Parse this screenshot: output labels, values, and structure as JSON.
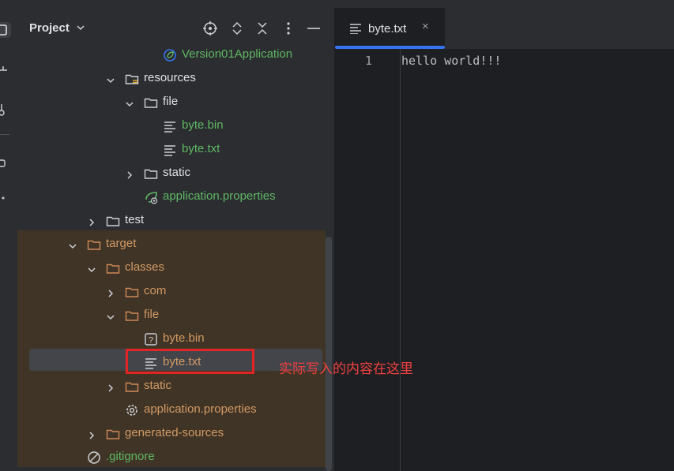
{
  "colors": {
    "normal_text": "#dfe1e5",
    "green_text": "#5fb865",
    "orange_text": "#d39a64",
    "excluded_bg": "#3f3426",
    "accent": "#3574f0",
    "annotation": "#e32424"
  },
  "project_panel": {
    "title": "Project",
    "header_icons": [
      "locate-icon",
      "expand-all-icon",
      "collapse-all-icon",
      "options-icon",
      "hide-icon"
    ]
  },
  "tree": [
    {
      "label": "Version01Application",
      "icon": "spring-boot-app-icon",
      "expanded": null,
      "color": "green"
    },
    {
      "label": "resources",
      "icon": "resources-folder-icon",
      "expanded": true,
      "color": "normal"
    },
    {
      "label": "file",
      "icon": "folder-icon",
      "expanded": true,
      "color": "normal"
    },
    {
      "label": "byte.bin",
      "icon": "text-file-icon",
      "expanded": null,
      "color": "green"
    },
    {
      "label": "byte.txt",
      "icon": "text-file-icon",
      "expanded": null,
      "color": "green"
    },
    {
      "label": "static",
      "icon": "folder-icon",
      "expanded": false,
      "color": "normal"
    },
    {
      "label": "application.properties",
      "icon": "spring-properties-icon",
      "expanded": null,
      "color": "green"
    },
    {
      "label": "test",
      "icon": "folder-icon",
      "expanded": false,
      "color": "normal"
    },
    {
      "label": "target",
      "icon": "excluded-folder-icon",
      "expanded": true,
      "color": "orange"
    },
    {
      "label": "classes",
      "icon": "excluded-folder-icon",
      "expanded": true,
      "color": "orange"
    },
    {
      "label": "com",
      "icon": "excluded-folder-icon",
      "expanded": false,
      "color": "orange"
    },
    {
      "label": "file",
      "icon": "excluded-folder-icon",
      "expanded": true,
      "color": "orange"
    },
    {
      "label": "byte.bin",
      "icon": "unknown-file-icon",
      "expanded": null,
      "color": "orange"
    },
    {
      "label": "byte.txt",
      "icon": "text-file-icon",
      "expanded": null,
      "color": "orange"
    },
    {
      "label": "static",
      "icon": "excluded-folder-icon",
      "expanded": false,
      "color": "orange"
    },
    {
      "label": "application.properties",
      "icon": "settings-file-icon",
      "expanded": null,
      "color": "orange"
    },
    {
      "label": "generated-sources",
      "icon": "excluded-folder-icon",
      "expanded": false,
      "color": "orange"
    },
    {
      "label": ".gitignore",
      "icon": "ignored-file-icon",
      "expanded": null,
      "color": "green"
    }
  ],
  "editor": {
    "tab_label": "byte.txt",
    "tab_close": "×",
    "line_number": "1",
    "content": "hello world!!!"
  },
  "annotation": {
    "text": "实际写入的内容在这里"
  }
}
